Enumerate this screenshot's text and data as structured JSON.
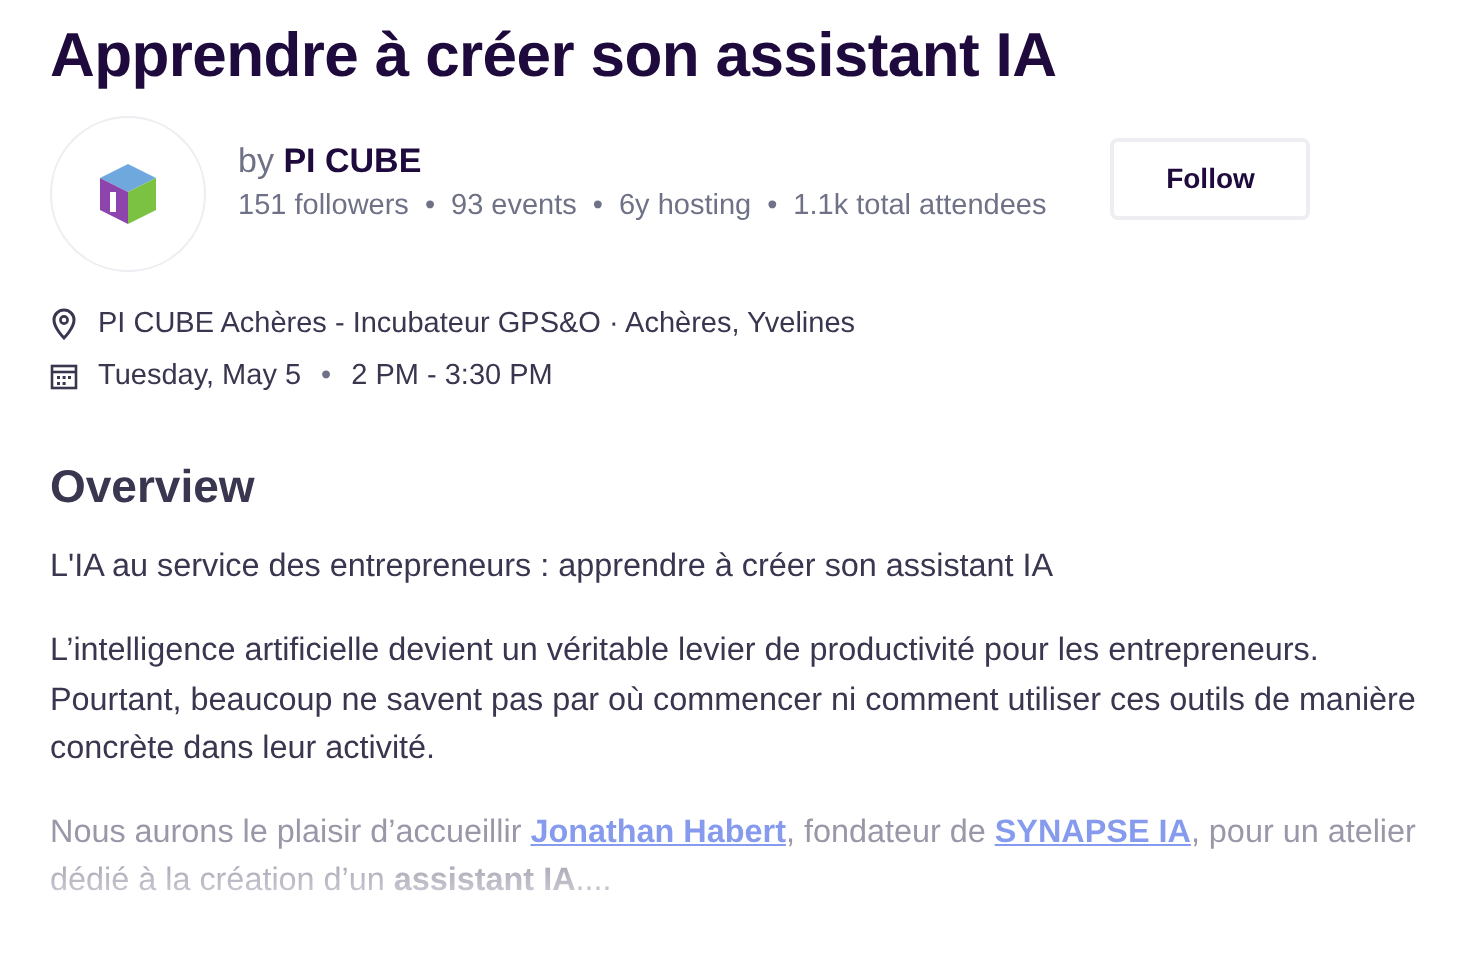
{
  "title": "Apprendre à créer son assistant IA",
  "organizer": {
    "by": "by",
    "name": "PI CUBE",
    "stats": [
      "151 followers",
      "93 events",
      "6y hosting",
      "1.1k total attendees"
    ],
    "separator": "•",
    "follow_button": "Follow"
  },
  "location": "PI CUBE Achères - Incubateur GPS&O · Achères, Yvelines",
  "date": {
    "day": "Tuesday, May 5",
    "separator": "•",
    "time": "2 PM - 3:30 PM"
  },
  "overview": {
    "heading": "Overview",
    "paragraphs": [
      {
        "parts": [
          {
            "kind": "text",
            "text": "L'IA au service des entrepreneurs : apprendre à créer son assistant IA"
          }
        ]
      },
      {
        "parts": [
          {
            "kind": "text",
            "text": "L’intelligence artificielle devient un véritable levier de productivité pour les entrepreneurs. Pourtant, beaucoup ne savent pas par où commencer ni comment utiliser ces outils de manière concrète dans leur activité."
          }
        ]
      },
      {
        "faded": true,
        "parts": [
          {
            "kind": "text",
            "text": "Nous aurons le plaisir d’accueillir "
          },
          {
            "kind": "link",
            "text": "Jonathan Habert"
          },
          {
            "kind": "text",
            "text": ", fondateur de "
          },
          {
            "kind": "link",
            "text": "SYNAPSE IA"
          },
          {
            "kind": "text",
            "text": ", pour un atelier dédié à la création d’un "
          },
          {
            "kind": "bold",
            "text": "assistant IA"
          },
          {
            "kind": "text",
            "text": "...."
          }
        ]
      }
    ]
  }
}
